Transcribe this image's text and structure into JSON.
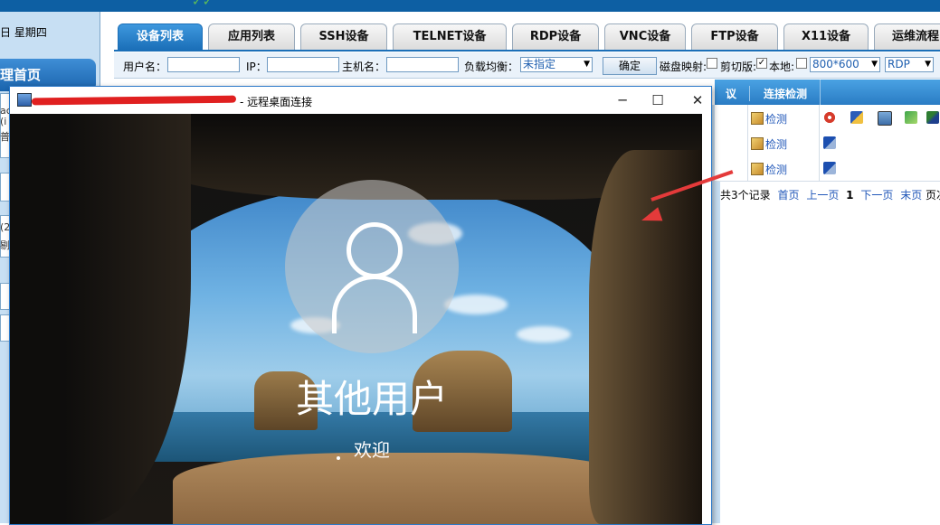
{
  "sidebar": {
    "date_text": "日 星期四",
    "home_label": "理首页",
    "fragments": [
      "ac",
      "(i",
      "普",
      "(2",
      "剔"
    ]
  },
  "tabs": [
    {
      "label": "设备列表",
      "active": true
    },
    {
      "label": "应用列表",
      "active": false
    },
    {
      "label": "SSH设备",
      "active": false
    },
    {
      "label": "TELNET设备",
      "active": false
    },
    {
      "label": "RDP设备",
      "active": false
    },
    {
      "label": "VNC设备",
      "active": false
    },
    {
      "label": "FTP设备",
      "active": false
    },
    {
      "label": "X11设备",
      "active": false
    },
    {
      "label": "运维流程",
      "active": false
    }
  ],
  "filter": {
    "username_label": "用户名：",
    "ip_label": "IP：",
    "hostname_label": "主机名：",
    "loadbalance_label": "负载均衡：",
    "loadbalance_value": "未指定",
    "confirm_label": "确定",
    "disk_map_label": "磁盘映射:",
    "clipboard_label": "剪切版:",
    "local_label": "本地:",
    "resolution_value": "800*600",
    "protocol_value": "RDP"
  },
  "table": {
    "col_protocol": "议",
    "col_detect": "连接检测",
    "rows": [
      {
        "detect": "检测"
      },
      {
        "detect": "检测"
      },
      {
        "detect": "检测"
      }
    ]
  },
  "pager": {
    "summary": "共3个记录",
    "first": "首页",
    "prev": "上一页",
    "current": "1",
    "next": "下一页",
    "last": "末页",
    "suffix": "页次"
  },
  "rdp_window": {
    "title_suffix": "- 远程桌面连接",
    "user_name": "其他用户",
    "welcome": "欢迎"
  },
  "colors": {
    "accent": "#1b6fb8",
    "banner": "#0d5fa3",
    "arrow": "#e43a3a",
    "link": "#1f56b8"
  }
}
